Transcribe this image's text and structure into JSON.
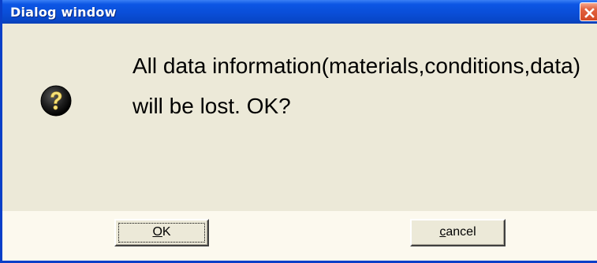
{
  "window": {
    "title": "Dialog window"
  },
  "icons": {
    "question": "question-icon",
    "close": "close-icon"
  },
  "message": {
    "text": "All data information(materials,conditions,data) will be lost. OK?"
  },
  "buttons": {
    "ok": {
      "mnemonic": "O",
      "rest": "K"
    },
    "cancel": {
      "mnemonic": "c",
      "rest": "ancel"
    }
  },
  "colors": {
    "titlebar": "#0a4ed8",
    "close_button": "#d44a24",
    "dialog_background": "#ece9d8",
    "button_strip": "#fcf9ee"
  }
}
